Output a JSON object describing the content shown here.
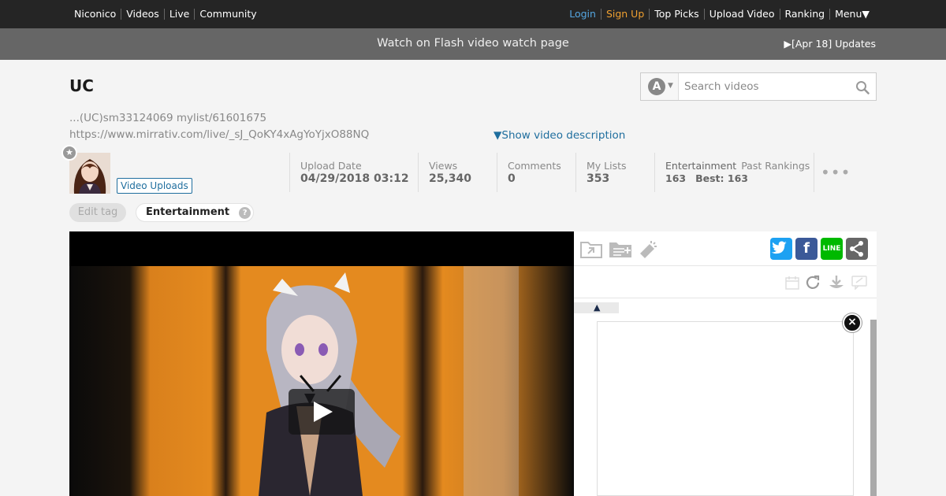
{
  "topbar": {
    "left_links": [
      "Niconico",
      "Videos",
      "Live",
      "Community"
    ],
    "login": "Login",
    "signup": "Sign Up",
    "right_links": [
      "Top Picks",
      "Upload Video",
      "Ranking",
      "Menu▼"
    ]
  },
  "flashbar": {
    "message": "Watch on Flash video watch page",
    "updates": "▶[Apr 18] Updates"
  },
  "video": {
    "title": "UC",
    "description_line1": "...(UC)sm33124069 mylist/61601675",
    "description_line2": "https://www.mirrativ.com/live/_sJ_QoKY4xAgYoYjxO88NQ",
    "show_description": "▼Show video description"
  },
  "search": {
    "type_glyph": "A",
    "placeholder": "Search videos"
  },
  "uploader": {
    "uploads_button": "Video Uploads"
  },
  "stats": {
    "upload_date_label": "Upload Date",
    "upload_date": "04/29/2018 03:12",
    "views_label": "Views",
    "views": "25,340",
    "comments_label": "Comments",
    "comments": "0",
    "mylists_label": "My Lists",
    "mylists": "353",
    "rank_category": "Entertainment",
    "past_rankings": "Past Rankings",
    "rank_current": "163",
    "rank_best": "Best: 163",
    "more": "•••"
  },
  "tags": {
    "edit_tag": "Edit tag",
    "items": [
      "Entertainment"
    ],
    "help_glyph": "?"
  },
  "side_panel": {
    "sns": {
      "twitter": "t",
      "facebook": "f",
      "line": "LINE",
      "share": "<"
    },
    "sort_glyph": "▲",
    "close_glyph": "×"
  },
  "colors": {
    "topbar_bg": "#252525",
    "flashbar_bg": "#666666",
    "login": "#55a6e0",
    "signup": "#f0a030",
    "link": "#1f6e9e",
    "twitter": "#1da1f2",
    "facebook": "#3b5998",
    "line": "#00b900"
  }
}
